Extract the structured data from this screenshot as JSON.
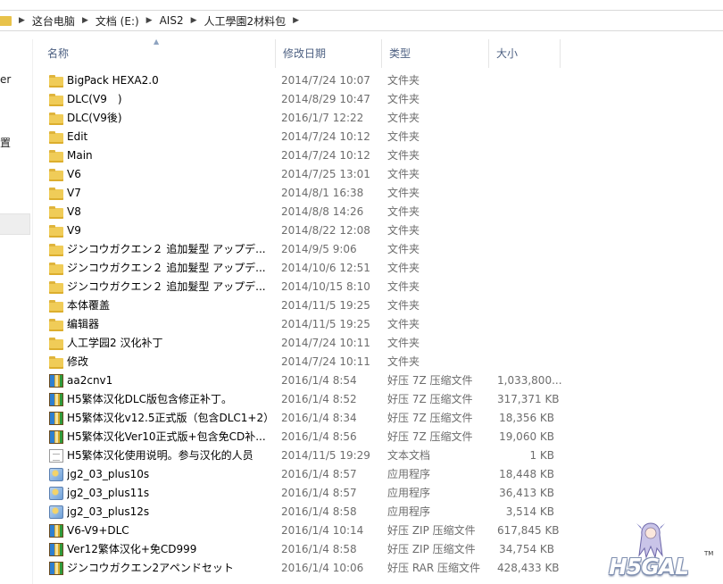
{
  "breadcrumb": [
    "这台电脑",
    "文档 (E:)",
    "AIS2",
    "人工學園2材料包"
  ],
  "nav": {
    "partial_label_1": "er",
    "partial_label_2": "置"
  },
  "columns": {
    "name": "名称",
    "date": "修改日期",
    "type": "类型",
    "size": "大小"
  },
  "files": [
    {
      "icon": "folder-icon",
      "name": "BigPack HEXA2.0",
      "date": "2014/7/24 10:07",
      "type": "文件夹",
      "size": ""
    },
    {
      "icon": "folder-icon",
      "name": "DLC(V9　)",
      "date": "2014/8/29 10:47",
      "type": "文件夹",
      "size": ""
    },
    {
      "icon": "folder-icon",
      "name": "DLC(V9後)",
      "date": "2016/1/7 12:22",
      "type": "文件夹",
      "size": ""
    },
    {
      "icon": "folder-icon",
      "name": "Edit",
      "date": "2014/7/24 10:12",
      "type": "文件夹",
      "size": ""
    },
    {
      "icon": "folder-icon",
      "name": "Main",
      "date": "2014/7/24 10:12",
      "type": "文件夹",
      "size": ""
    },
    {
      "icon": "folder-icon",
      "name": "V6",
      "date": "2014/7/25 13:01",
      "type": "文件夹",
      "size": ""
    },
    {
      "icon": "folder-icon",
      "name": "V7",
      "date": "2014/8/1 16:38",
      "type": "文件夹",
      "size": ""
    },
    {
      "icon": "folder-icon",
      "name": "V8",
      "date": "2014/8/8 14:26",
      "type": "文件夹",
      "size": ""
    },
    {
      "icon": "folder-icon",
      "name": "V9",
      "date": "2014/8/22 12:08",
      "type": "文件夹",
      "size": ""
    },
    {
      "icon": "folder-icon",
      "name": "ジンコウガクエン２ 追加髮型 アップデ...",
      "date": "2014/9/5 9:06",
      "type": "文件夹",
      "size": ""
    },
    {
      "icon": "folder-icon",
      "name": "ジンコウガクエン２ 追加髮型 アップデ...",
      "date": "2014/10/6 12:51",
      "type": "文件夹",
      "size": ""
    },
    {
      "icon": "folder-icon",
      "name": "ジンコウガクエン２ 追加髮型 アップデ...",
      "date": "2014/10/15 8:10",
      "type": "文件夹",
      "size": ""
    },
    {
      "icon": "folder-icon",
      "name": "本体覆盖",
      "date": "2014/11/5 19:25",
      "type": "文件夹",
      "size": ""
    },
    {
      "icon": "folder-icon",
      "name": "编辑器",
      "date": "2014/11/5 19:25",
      "type": "文件夹",
      "size": ""
    },
    {
      "icon": "folder-icon",
      "name": "人工学园2 汉化补丁",
      "date": "2014/7/24 10:11",
      "type": "文件夹",
      "size": ""
    },
    {
      "icon": "folder-icon",
      "name": "修改",
      "date": "2014/7/24 10:11",
      "type": "文件夹",
      "size": ""
    },
    {
      "icon": "archive-icon",
      "name": "aa2cnv1",
      "date": "2016/1/4 8:54",
      "type": "好压 7Z 压缩文件",
      "size": "1,033,800..."
    },
    {
      "icon": "archive-icon",
      "name": "H5繁体汉化DLC版包含修正补丁。",
      "date": "2016/1/4 8:52",
      "type": "好压 7Z 压缩文件",
      "size": "317,371 KB"
    },
    {
      "icon": "archive-icon",
      "name": "H5繁体汉化v12.5正式版（包含DLC1+2）",
      "date": "2016/1/4 8:34",
      "type": "好压 7Z 压缩文件",
      "size": "18,356 KB"
    },
    {
      "icon": "archive-icon",
      "name": "H5繁体汉化Ver10正式版+包含免CD补...",
      "date": "2016/1/4 8:56",
      "type": "好压 7Z 压缩文件",
      "size": "19,060 KB"
    },
    {
      "icon": "doc-icon",
      "name": "H5繁体汉化使用说明。参与汉化的人员",
      "date": "2014/11/5 19:29",
      "type": "文本文档",
      "size": "1 KB"
    },
    {
      "icon": "app-icon",
      "name": "jg2_03_plus10s",
      "date": "2016/1/4 8:57",
      "type": "应用程序",
      "size": "18,448 KB"
    },
    {
      "icon": "app-icon",
      "name": "jg2_03_plus11s",
      "date": "2016/1/4 8:57",
      "type": "应用程序",
      "size": "36,413 KB"
    },
    {
      "icon": "app-icon",
      "name": "jg2_03_plus12s",
      "date": "2016/1/4 8:58",
      "type": "应用程序",
      "size": "3,514 KB"
    },
    {
      "icon": "archive-icon",
      "name": "V6-V9+DLC",
      "date": "2016/1/4 10:14",
      "type": "好压 ZIP 压缩文件",
      "size": "617,845 KB"
    },
    {
      "icon": "archive-icon",
      "name": "Ver12繁体汉化+免CD999",
      "date": "2016/1/4 8:58",
      "type": "好压 ZIP 压缩文件",
      "size": "34,754 KB"
    },
    {
      "icon": "archive-icon",
      "name": "ジンコウガクエン2アペンドセット",
      "date": "2016/1/4 10:06",
      "type": "好压 RAR 压缩文件",
      "size": "428,433 KB"
    }
  ],
  "watermark": {
    "logo_text": "H5GAL",
    "trademark": "TM"
  }
}
